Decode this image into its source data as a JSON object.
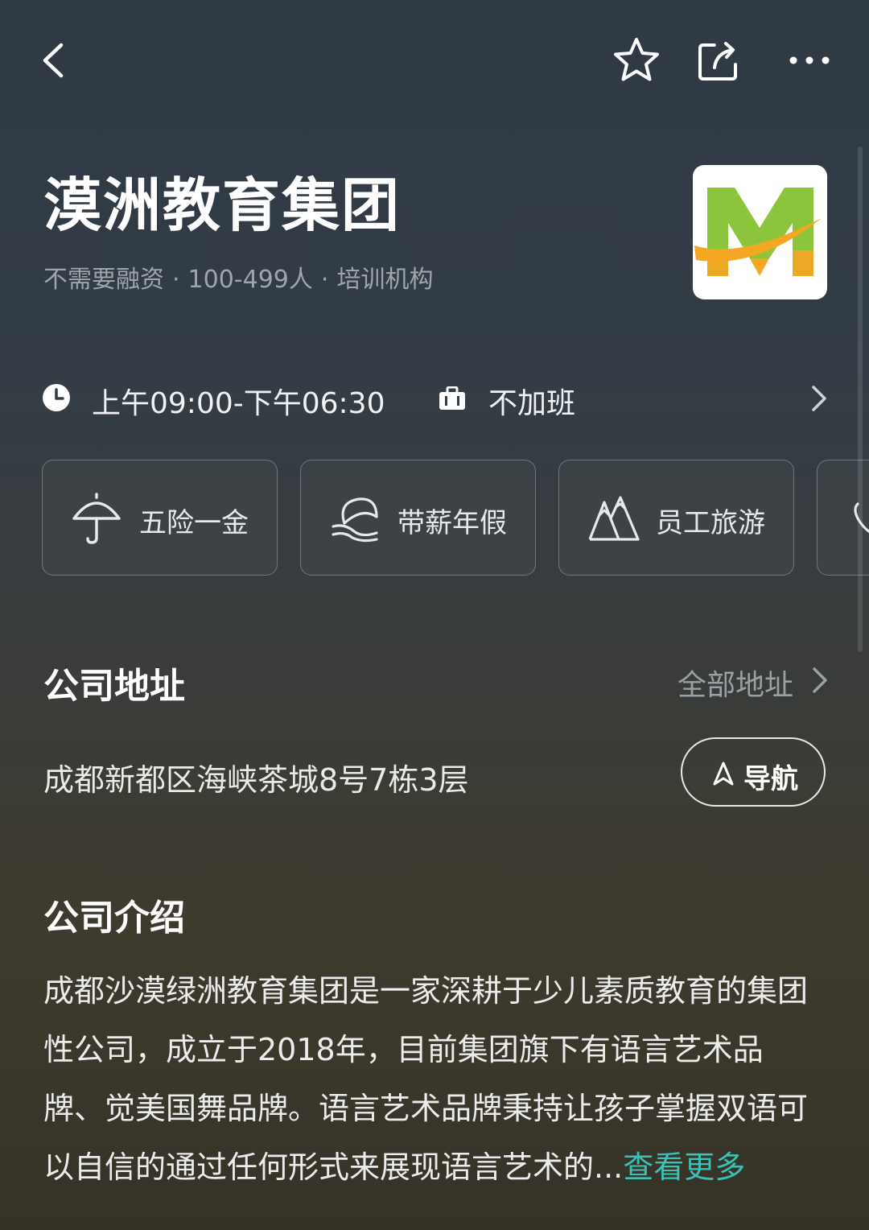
{
  "topbar": {
    "back_icon": "chevron-left-icon",
    "favorite_icon": "star-icon",
    "share_icon": "share-icon",
    "more_icon": "more-icon"
  },
  "company": {
    "name": "漠洲教育集团",
    "financing": "不需要融资",
    "size": "100-499人",
    "industry": "培训机构",
    "separator": "·",
    "logo_letter": "M",
    "logo_colors": {
      "green": "#8cc43c",
      "orange": "#f5a623"
    }
  },
  "work": {
    "hours": "上午09:00-下午06:30",
    "overtime": "不加班"
  },
  "benefits": [
    {
      "label": "五险一金",
      "icon": "umbrella-icon"
    },
    {
      "label": "带薪年假",
      "icon": "beach-icon"
    },
    {
      "label": "员工旅游",
      "icon": "mountain-icon"
    }
  ],
  "address_section": {
    "title": "公司地址",
    "all_link": "全部地址",
    "address": "成都新都区海峡茶城8号7栋3层",
    "nav_button": "导航"
  },
  "intro_section": {
    "title": "公司介绍",
    "text": "成都沙漠绿洲教育集团是一家深耕于少儿素质教育的集团性公司，成立于2018年，目前集团旗下有语言艺术品牌、觉美国舞品牌。语言艺术品牌秉持让孩子掌握双语可以自信的通过任何形式来展现语言艺术的...",
    "more_link": "查看更多",
    "more_color": "#3cc0b7"
  }
}
